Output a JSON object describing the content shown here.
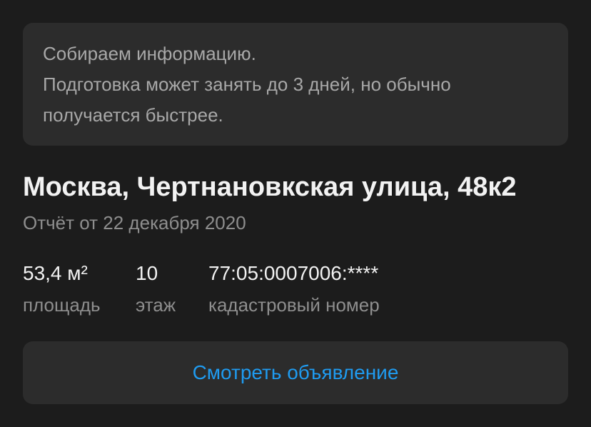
{
  "info_banner": {
    "lines": [
      "Собираем информацию.",
      "Подготовка может занять до 3 дней, но обычно",
      "получается быстрее."
    ]
  },
  "property": {
    "address": "Москва, Чертнановкская улица, 48к2",
    "report_date": "Отчёт от 22 декабря 2020"
  },
  "stats": {
    "area": {
      "value": "53,4 м²",
      "label": "площадь"
    },
    "floor": {
      "value": "10",
      "label": "этаж"
    },
    "cadastral": {
      "value": "77:05:0007006:****",
      "label": "кадастровый номер"
    }
  },
  "actions": {
    "view_listing_label": "Смотреть объявление"
  },
  "colors": {
    "background": "#1c1c1c",
    "card": "#2c2c2c",
    "accent_link": "#1f9bf0"
  }
}
